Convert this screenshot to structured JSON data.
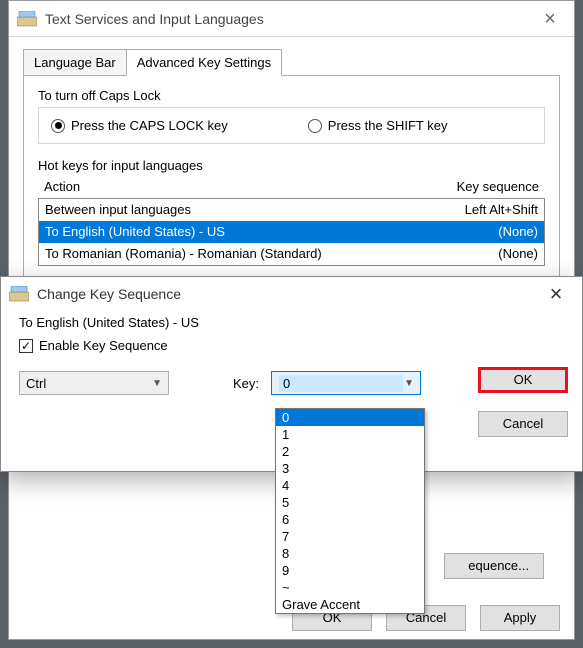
{
  "parent": {
    "title": "Text Services and Input Languages",
    "tabs": {
      "language_bar": "Language Bar",
      "advanced": "Advanced Key Settings"
    },
    "caps_group": {
      "label": "To turn off Caps Lock",
      "opt1": "Press the CAPS LOCK key",
      "opt2": "Press the SHIFT key"
    },
    "hotkeys": {
      "label": "Hot keys for input languages",
      "col_action": "Action",
      "col_seq": "Key sequence",
      "rows": [
        {
          "action": "Between input languages",
          "seq": "Left Alt+Shift"
        },
        {
          "action": "To English (United States) - US",
          "seq": "(None)"
        },
        {
          "action": "To Romanian (Romania) - Romanian (Standard)",
          "seq": "(None)"
        }
      ]
    },
    "change_seq_btn": "Change Key Sequence...",
    "change_seq_btn_partial": "equence...",
    "ok": "OK",
    "cancel": "Cancel",
    "apply": "Apply"
  },
  "child": {
    "title": "Change Key Sequence",
    "subtitle": "To English (United States) - US",
    "enable_label": "Enable Key Sequence",
    "modifier": "Ctrl",
    "key_label": "Key:",
    "key_value": "0",
    "ok": "OK",
    "cancel": "Cancel"
  },
  "dropdown": {
    "items": [
      "0",
      "1",
      "2",
      "3",
      "4",
      "5",
      "6",
      "7",
      "8",
      "9",
      "~",
      "Grave Accent"
    ]
  }
}
